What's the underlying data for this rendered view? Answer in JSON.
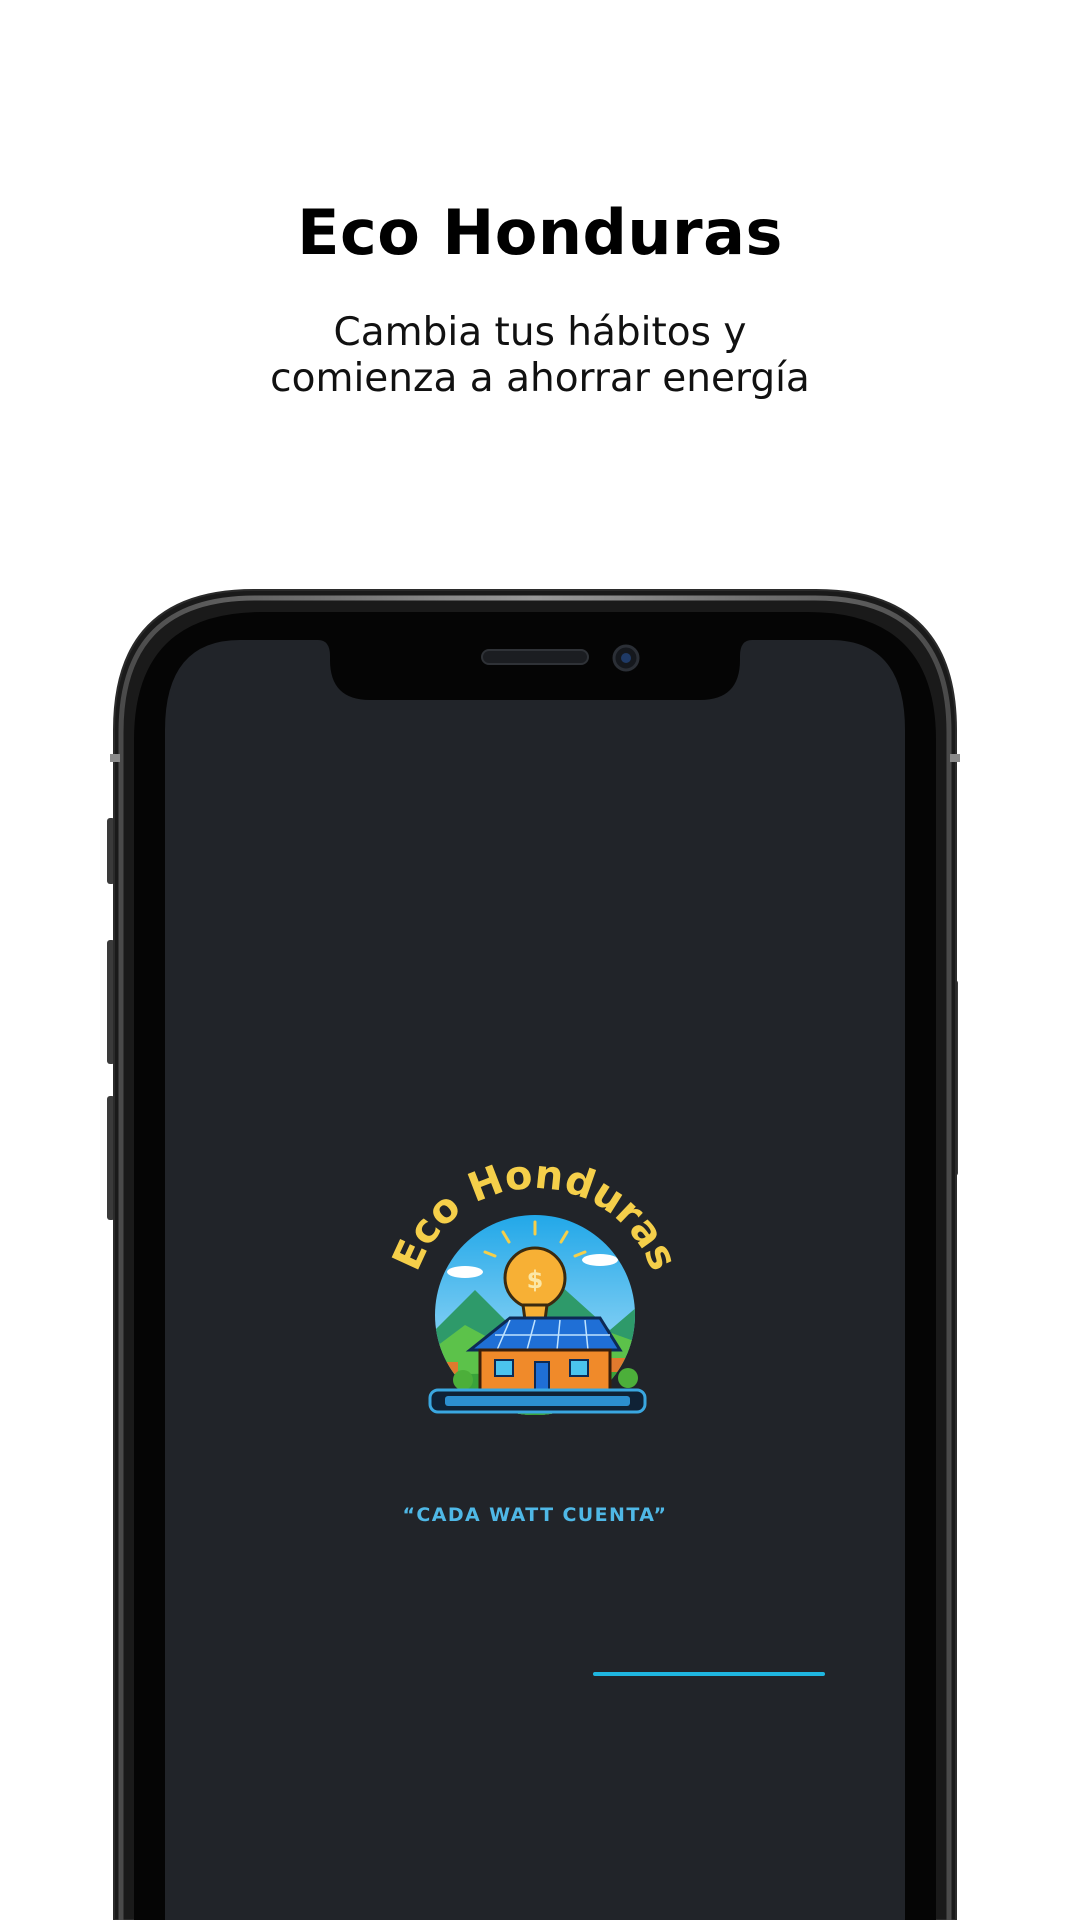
{
  "header": {
    "title": "Eco Honduras",
    "subtitle_line1": "Cambia tus hábitos y",
    "subtitle_line2": "comienza a ahorrar energía"
  },
  "splash": {
    "logo_text": "Eco Honduras",
    "tagline": "“CADA WATT CUENTA”",
    "loading_progress": 0.55
  },
  "colors": {
    "page_background": "#ffffff",
    "screen_background": "#212429",
    "logo_text": "#f5cf4a",
    "tagline": "#4fb8e6",
    "loading_bar": "#1fb6e0"
  }
}
